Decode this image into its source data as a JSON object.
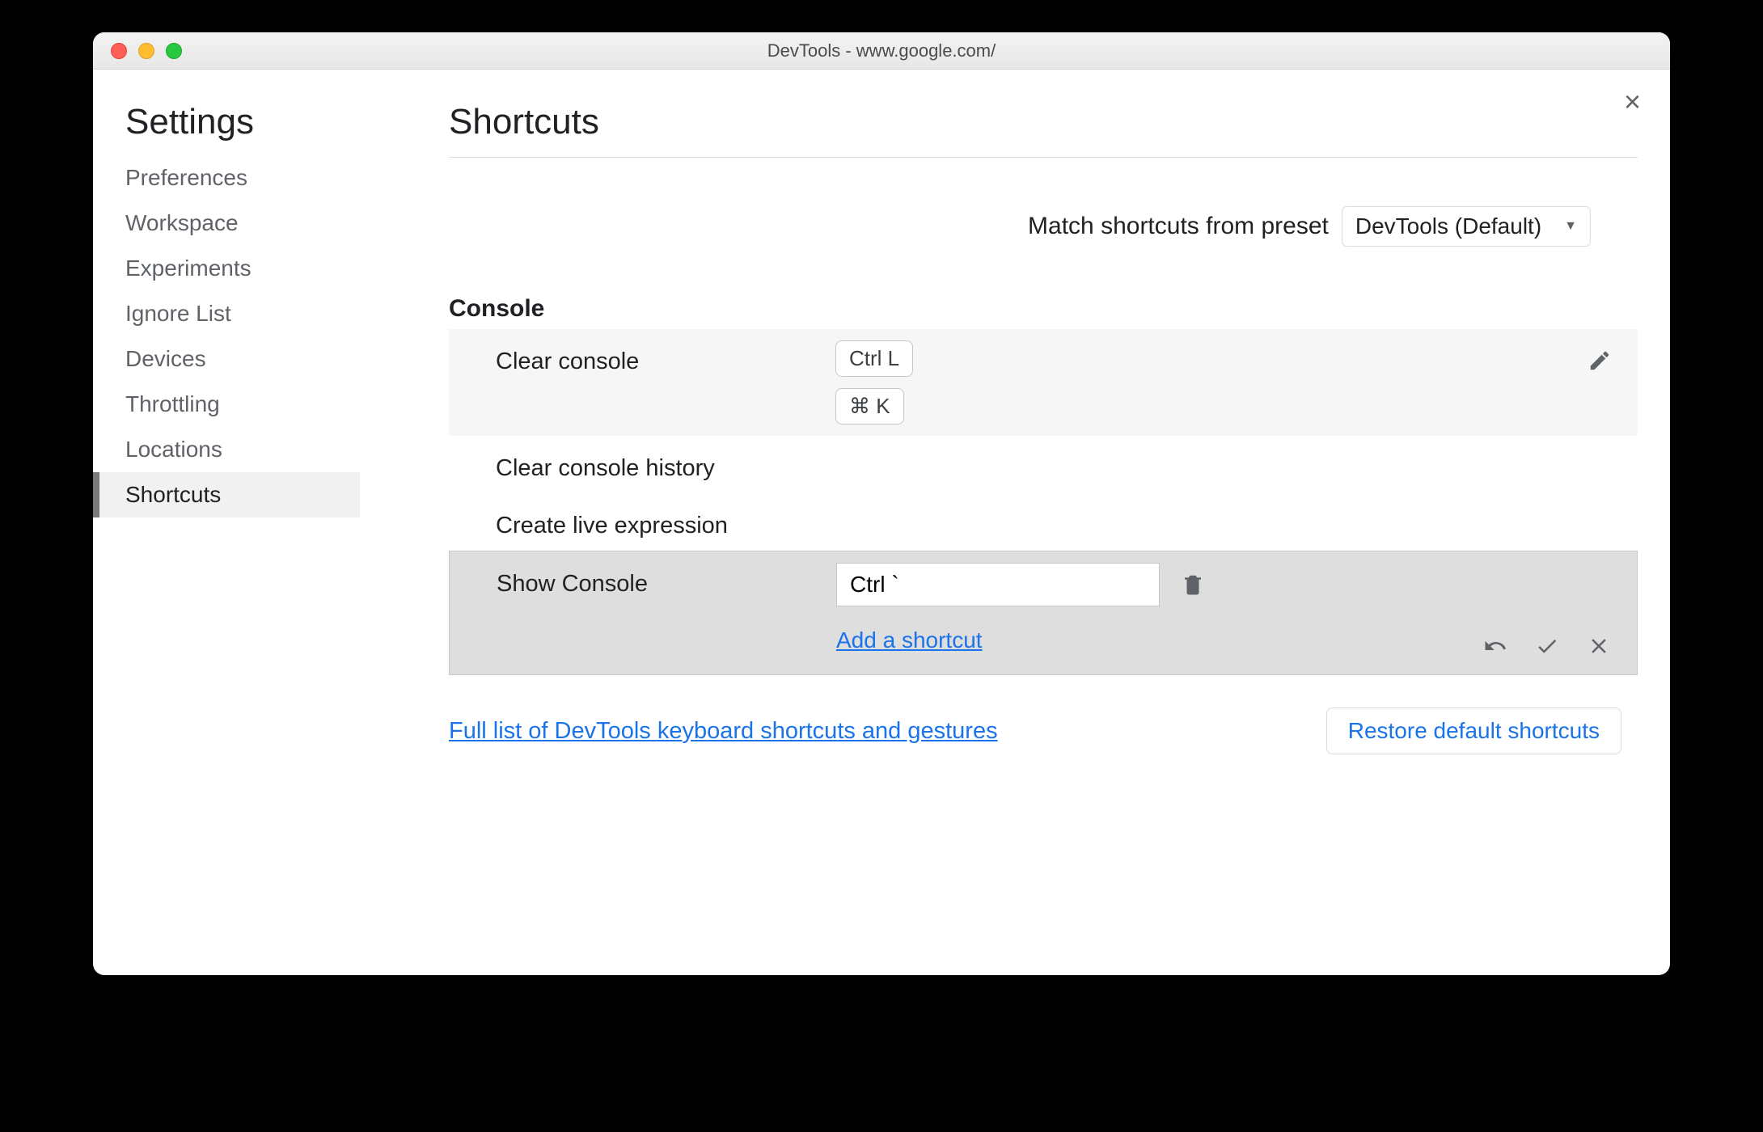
{
  "window": {
    "title": "DevTools - www.google.com/"
  },
  "sidebar": {
    "heading": "Settings",
    "items": [
      {
        "label": "Preferences"
      },
      {
        "label": "Workspace"
      },
      {
        "label": "Experiments"
      },
      {
        "label": "Ignore List"
      },
      {
        "label": "Devices"
      },
      {
        "label": "Throttling"
      },
      {
        "label": "Locations"
      },
      {
        "label": "Shortcuts"
      }
    ]
  },
  "page": {
    "title": "Shortcuts",
    "preset_label": "Match shortcuts from preset",
    "preset_value": "DevTools (Default)"
  },
  "section": {
    "title": "Console",
    "rows": {
      "clear_console": {
        "name": "Clear console",
        "key1": "Ctrl L",
        "key2": "⌘ K"
      },
      "clear_history": {
        "name": "Clear console history"
      },
      "create_live": {
        "name": "Create live expression"
      },
      "show_console": {
        "name": "Show Console",
        "input_value": "Ctrl `",
        "add_link": "Add a shortcut"
      }
    }
  },
  "footer": {
    "link": "Full list of DevTools keyboard shortcuts and gestures",
    "restore": "Restore default shortcuts"
  }
}
